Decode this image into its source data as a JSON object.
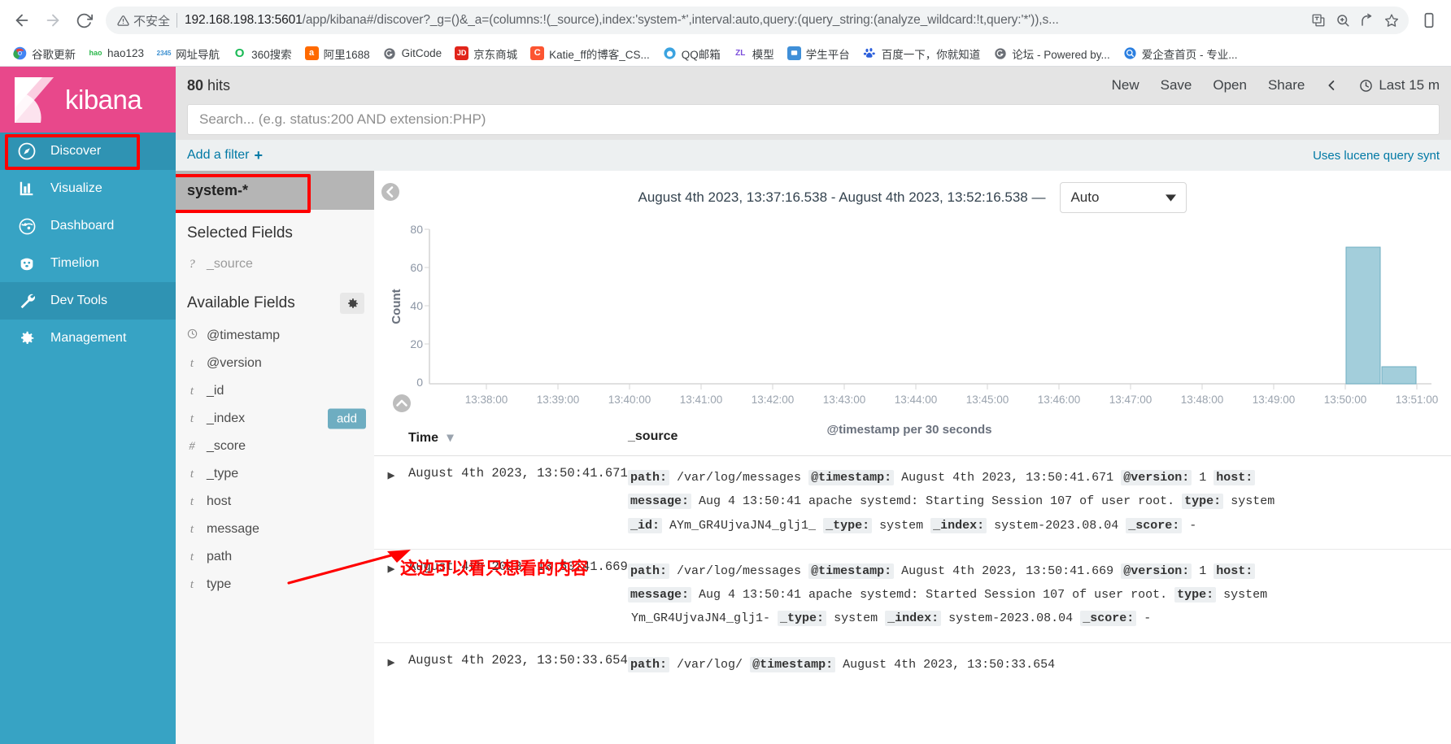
{
  "browser": {
    "back_label": "Back",
    "forward_label": "Forward",
    "reload_label": "Reload",
    "security_label": "不安全",
    "url_host": "192.168.198.13:5601",
    "url_rest": "/app/kibana#/discover?_g=()&_a=(columns:!(_source),index:'system-*',interval:auto,query:(query_string:(analyze_wildcard:!t,query:'*')),s...",
    "translate_icon": "translate-icon",
    "zoom_icon": "zoom-icon",
    "share_icon": "share-icon",
    "bookmark_icon": "star-icon",
    "profile_icon": "profile-icon",
    "bookmarks": [
      {
        "label": "谷歌更新",
        "icon": "chrome-icon",
        "color": "#ffffff",
        "glyph": ""
      },
      {
        "label": "hao123",
        "icon": "hao123-icon",
        "color": "#ffffff",
        "glyph": ""
      },
      {
        "label": "网址导航",
        "icon": "site-nav-icon",
        "color": "#ffffff",
        "glyph": ""
      },
      {
        "label": "360搜索",
        "icon": "so360-icon",
        "color": "#ffffff",
        "glyph": ""
      },
      {
        "label": "阿里1688",
        "icon": "alibaba-icon",
        "color": "#ff6a00",
        "glyph": "a"
      },
      {
        "label": "GitCode",
        "icon": "gitcode-icon",
        "color": "#ffffff",
        "glyph": ""
      },
      {
        "label": "京东商城",
        "icon": "jd-icon",
        "color": "#e1251b",
        "glyph": "JD"
      },
      {
        "label": "Katie_ff的博客_CS...",
        "icon": "csdn-icon",
        "color": "#fc5531",
        "glyph": "C"
      },
      {
        "label": "QQ邮箱",
        "icon": "qqmail-icon",
        "color": "#ffffff",
        "glyph": ""
      },
      {
        "label": "模型",
        "icon": "zl-model-icon",
        "color": "#ffffff",
        "glyph": "ZL"
      },
      {
        "label": "学生平台",
        "icon": "student-platform-icon",
        "color": "#3f8fd8",
        "glyph": ""
      },
      {
        "label": "百度一下，你就知道",
        "icon": "baidu-icon",
        "color": "#ffffff",
        "glyph": ""
      },
      {
        "label": "论坛 - Powered by...",
        "icon": "forum-icon",
        "color": "#ffffff",
        "glyph": ""
      },
      {
        "label": "爱企查首页 - 专业...",
        "icon": "aiqicha-icon",
        "color": "#ffffff",
        "glyph": ""
      }
    ]
  },
  "sidebar": {
    "logo_text": "kibana",
    "items": [
      {
        "label": "Discover",
        "icon": "compass-icon",
        "active": true
      },
      {
        "label": "Visualize",
        "icon": "bar-chart-icon",
        "active": false
      },
      {
        "label": "Dashboard",
        "icon": "dashboard-icon",
        "active": false
      },
      {
        "label": "Timelion",
        "icon": "timelion-icon",
        "active": false
      },
      {
        "label": "Dev Tools",
        "icon": "wrench-icon",
        "active": true
      },
      {
        "label": "Management",
        "icon": "gear-icon",
        "active": false
      }
    ]
  },
  "topbar": {
    "hits_count": "80",
    "hits_suffix": " hits",
    "actions": [
      "New",
      "Save",
      "Open",
      "Share"
    ],
    "collapse_icon": "chevron-left-icon",
    "clock_icon": "clock-icon",
    "time_range_label": "Last 15 m"
  },
  "search": {
    "placeholder": "Search... (e.g. status:200 AND extension:PHP)",
    "value": "",
    "lucene_note": "Uses lucene query synt"
  },
  "filters": {
    "add_filter_label": "Add a filter",
    "plus_icon": "plus-icon"
  },
  "fields_panel": {
    "index_pattern": "system-*",
    "selected_fields_title": "Selected Fields",
    "available_fields_title": "Available Fields",
    "gear_icon": "gear-icon",
    "add_badge_label": "add",
    "selected": [
      {
        "type": "?",
        "name": "_source"
      }
    ],
    "available": [
      {
        "type": "clock",
        "name": "@timestamp"
      },
      {
        "type": "t",
        "name": "@version"
      },
      {
        "type": "t",
        "name": "_id"
      },
      {
        "type": "t",
        "name": "_index"
      },
      {
        "type": "#",
        "name": "_score"
      },
      {
        "type": "t",
        "name": "_type"
      },
      {
        "type": "t",
        "name": "host"
      },
      {
        "type": "t",
        "name": "message"
      },
      {
        "type": "t",
        "name": "path"
      },
      {
        "type": "t",
        "name": "type"
      }
    ]
  },
  "chart_panel": {
    "collapse_left_icon": "chevron-left-circle-icon",
    "collapse_chart_icon": "chevron-up-circle-icon",
    "range_label": "August 4th 2023, 13:37:16.538 - August 4th 2023, 13:52:16.538 —",
    "interval_value": "Auto",
    "interval_caret_icon": "chevron-down-icon"
  },
  "chart_data": {
    "type": "bar",
    "title": "",
    "xlabel": "@timestamp per 30 seconds",
    "ylabel": "Count",
    "ylim": [
      0,
      80
    ],
    "yticks": [
      0,
      20,
      40,
      60,
      80
    ],
    "grid": false,
    "legend": "none",
    "bar_color": "#a3cedb",
    "bar_stroke": "#6eadc1",
    "x_start": "13:37:16",
    "x_end": "13:52:16",
    "xticks": [
      "13:38:00",
      "13:39:00",
      "13:40:00",
      "13:41:00",
      "13:42:00",
      "13:43:00",
      "13:44:00",
      "13:45:00",
      "13:46:00",
      "13:47:00",
      "13:48:00",
      "13:49:00",
      "13:50:00",
      "13:51:00"
    ],
    "categories": [
      "13:50:00",
      "13:50:30"
    ],
    "values": [
      71,
      9
    ]
  },
  "doc_table": {
    "columns": [
      {
        "label": "Time",
        "sort_icon": "sort-desc-icon"
      },
      {
        "label": "_source"
      }
    ],
    "expand_icon": "caret-right-icon",
    "rows": [
      {
        "time": "August 4th 2023, 13:50:41.671",
        "lines": [
          [
            {
              "k": "path:",
              "v": "/var/log/messages"
            },
            {
              "k": "@timestamp:",
              "v": "August 4th 2023, 13:50:41.671"
            },
            {
              "k": "@version:",
              "v": "1"
            },
            {
              "k": "host:",
              "v": ""
            }
          ],
          [
            {
              "k": "message:",
              "v": "Aug 4 13:50:41 apache systemd: Starting Session 107 of user root."
            },
            {
              "k": "type:",
              "v": "system"
            }
          ],
          [
            {
              "k": "_id:",
              "v": "AYm_GR4UjvaJN4_glj1_"
            },
            {
              "k": "_type:",
              "v": "system"
            },
            {
              "k": "_index:",
              "v": "system-2023.08.04"
            },
            {
              "k": "_score:",
              "v": "-"
            }
          ]
        ]
      },
      {
        "time": "August 4th 2023, 13:50:41.669",
        "lines": [
          [
            {
              "k": "path:",
              "v": "/var/log/messages"
            },
            {
              "k": "@timestamp:",
              "v": "August 4th 2023, 13:50:41.669"
            },
            {
              "k": "@version:",
              "v": "1"
            },
            {
              "k": "host:",
              "v": ""
            }
          ],
          [
            {
              "k": "message:",
              "v": "Aug 4 13:50:41 apache systemd: Started Session 107 of user root."
            },
            {
              "k": "type:",
              "v": "system"
            }
          ],
          [
            {
              "k": "",
              "v": "Ym_GR4UjvaJN4_glj1-"
            },
            {
              "k": "_type:",
              "v": "system"
            },
            {
              "k": "_index:",
              "v": "system-2023.08.04"
            },
            {
              "k": "_score:",
              "v": "-"
            }
          ]
        ]
      },
      {
        "time": "August 4th 2023, 13:50:33.654",
        "lines": [
          [
            {
              "k": "path:",
              "v": "/var/log/"
            },
            {
              "k": "@timestamp:",
              "v": "August 4th 2023, 13:50:33.654"
            }
          ]
        ]
      }
    ]
  },
  "annotation": {
    "text": "这边可以看只想看的内容",
    "color": "#ff0000",
    "arrow_icon": "arrow-icon"
  },
  "highlights": {
    "color": "#ff0000",
    "targets": [
      "sidebar-item-discover",
      "index-pattern-system"
    ]
  }
}
